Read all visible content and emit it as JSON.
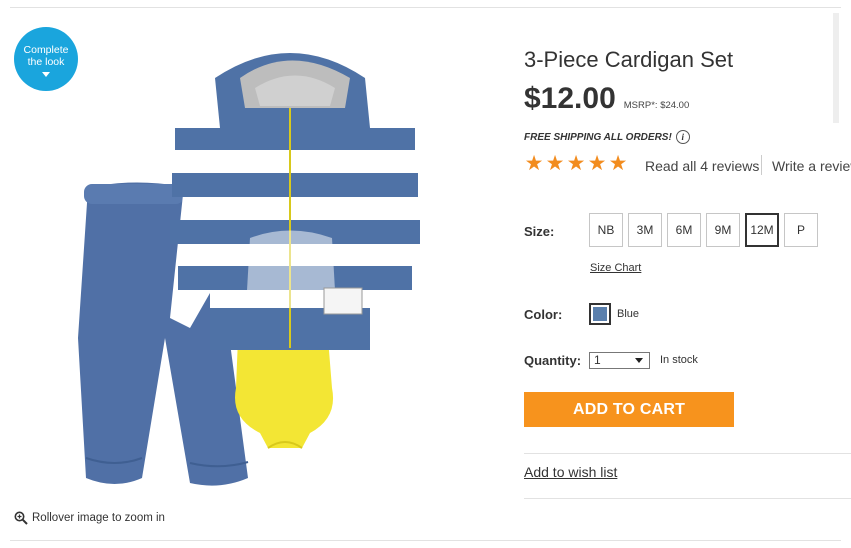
{
  "badge": {
    "line1": "Complete",
    "line2": "the look"
  },
  "product": {
    "title": "3-Piece Cardigan Set",
    "price": "$12.00",
    "msrp": "MSRP*: $24.00",
    "shipping": "FREE SHIPPING ALL ORDERS!",
    "info_icon": "i",
    "rating": 5,
    "reviews_link": "Read all 4 reviews",
    "write_review": "Write a review"
  },
  "size": {
    "label": "Size:",
    "options": [
      "NB",
      "3M",
      "6M",
      "9M",
      "12M",
      "P"
    ],
    "selected": "12M",
    "chart_link": "Size Chart"
  },
  "color": {
    "label": "Color:",
    "name": "Blue",
    "swatch": "#5b80ad"
  },
  "quantity": {
    "label": "Quantity:",
    "value": "1",
    "stock": "In stock"
  },
  "actions": {
    "add_to_cart": "ADD TO CART",
    "wishlist": "Add to wish list"
  },
  "zoom_hint": "Rollover image to zoom in",
  "colors": {
    "accent_orange": "#f7931d",
    "star_orange": "#f28c1e",
    "badge_blue": "#1aa5dd",
    "stripe_blue": "#4f72a6",
    "onesie_yellow": "#f3e634"
  }
}
